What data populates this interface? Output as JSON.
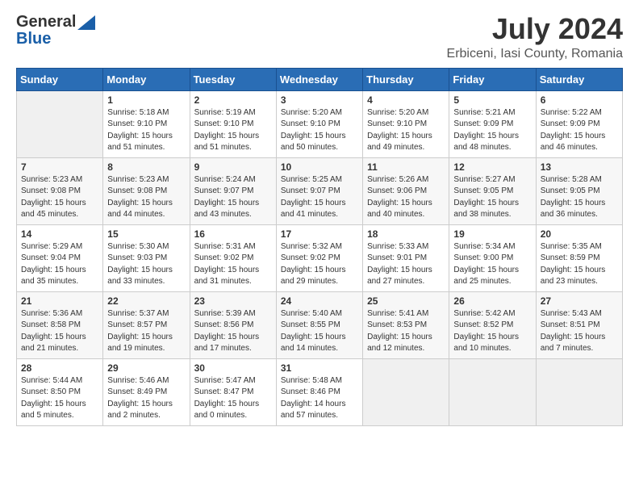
{
  "header": {
    "logo": {
      "general": "General",
      "blue": "Blue"
    },
    "title": "July 2024",
    "subtitle": "Erbiceni, Iasi County, Romania"
  },
  "weekdays": [
    "Sunday",
    "Monday",
    "Tuesday",
    "Wednesday",
    "Thursday",
    "Friday",
    "Saturday"
  ],
  "weeks": [
    [
      {
        "day": "",
        "sunrise": "",
        "sunset": "",
        "daylight": "",
        "empty": true
      },
      {
        "day": "1",
        "sunrise": "Sunrise: 5:18 AM",
        "sunset": "Sunset: 9:10 PM",
        "daylight": "Daylight: 15 hours and 51 minutes."
      },
      {
        "day": "2",
        "sunrise": "Sunrise: 5:19 AM",
        "sunset": "Sunset: 9:10 PM",
        "daylight": "Daylight: 15 hours and 51 minutes."
      },
      {
        "day": "3",
        "sunrise": "Sunrise: 5:20 AM",
        "sunset": "Sunset: 9:10 PM",
        "daylight": "Daylight: 15 hours and 50 minutes."
      },
      {
        "day": "4",
        "sunrise": "Sunrise: 5:20 AM",
        "sunset": "Sunset: 9:10 PM",
        "daylight": "Daylight: 15 hours and 49 minutes."
      },
      {
        "day": "5",
        "sunrise": "Sunrise: 5:21 AM",
        "sunset": "Sunset: 9:09 PM",
        "daylight": "Daylight: 15 hours and 48 minutes."
      },
      {
        "day": "6",
        "sunrise": "Sunrise: 5:22 AM",
        "sunset": "Sunset: 9:09 PM",
        "daylight": "Daylight: 15 hours and 46 minutes."
      }
    ],
    [
      {
        "day": "7",
        "sunrise": "Sunrise: 5:23 AM",
        "sunset": "Sunset: 9:08 PM",
        "daylight": "Daylight: 15 hours and 45 minutes."
      },
      {
        "day": "8",
        "sunrise": "Sunrise: 5:23 AM",
        "sunset": "Sunset: 9:08 PM",
        "daylight": "Daylight: 15 hours and 44 minutes."
      },
      {
        "day": "9",
        "sunrise": "Sunrise: 5:24 AM",
        "sunset": "Sunset: 9:07 PM",
        "daylight": "Daylight: 15 hours and 43 minutes."
      },
      {
        "day": "10",
        "sunrise": "Sunrise: 5:25 AM",
        "sunset": "Sunset: 9:07 PM",
        "daylight": "Daylight: 15 hours and 41 minutes."
      },
      {
        "day": "11",
        "sunrise": "Sunrise: 5:26 AM",
        "sunset": "Sunset: 9:06 PM",
        "daylight": "Daylight: 15 hours and 40 minutes."
      },
      {
        "day": "12",
        "sunrise": "Sunrise: 5:27 AM",
        "sunset": "Sunset: 9:05 PM",
        "daylight": "Daylight: 15 hours and 38 minutes."
      },
      {
        "day": "13",
        "sunrise": "Sunrise: 5:28 AM",
        "sunset": "Sunset: 9:05 PM",
        "daylight": "Daylight: 15 hours and 36 minutes."
      }
    ],
    [
      {
        "day": "14",
        "sunrise": "Sunrise: 5:29 AM",
        "sunset": "Sunset: 9:04 PM",
        "daylight": "Daylight: 15 hours and 35 minutes."
      },
      {
        "day": "15",
        "sunrise": "Sunrise: 5:30 AM",
        "sunset": "Sunset: 9:03 PM",
        "daylight": "Daylight: 15 hours and 33 minutes."
      },
      {
        "day": "16",
        "sunrise": "Sunrise: 5:31 AM",
        "sunset": "Sunset: 9:02 PM",
        "daylight": "Daylight: 15 hours and 31 minutes."
      },
      {
        "day": "17",
        "sunrise": "Sunrise: 5:32 AM",
        "sunset": "Sunset: 9:02 PM",
        "daylight": "Daylight: 15 hours and 29 minutes."
      },
      {
        "day": "18",
        "sunrise": "Sunrise: 5:33 AM",
        "sunset": "Sunset: 9:01 PM",
        "daylight": "Daylight: 15 hours and 27 minutes."
      },
      {
        "day": "19",
        "sunrise": "Sunrise: 5:34 AM",
        "sunset": "Sunset: 9:00 PM",
        "daylight": "Daylight: 15 hours and 25 minutes."
      },
      {
        "day": "20",
        "sunrise": "Sunrise: 5:35 AM",
        "sunset": "Sunset: 8:59 PM",
        "daylight": "Daylight: 15 hours and 23 minutes."
      }
    ],
    [
      {
        "day": "21",
        "sunrise": "Sunrise: 5:36 AM",
        "sunset": "Sunset: 8:58 PM",
        "daylight": "Daylight: 15 hours and 21 minutes."
      },
      {
        "day": "22",
        "sunrise": "Sunrise: 5:37 AM",
        "sunset": "Sunset: 8:57 PM",
        "daylight": "Daylight: 15 hours and 19 minutes."
      },
      {
        "day": "23",
        "sunrise": "Sunrise: 5:39 AM",
        "sunset": "Sunset: 8:56 PM",
        "daylight": "Daylight: 15 hours and 17 minutes."
      },
      {
        "day": "24",
        "sunrise": "Sunrise: 5:40 AM",
        "sunset": "Sunset: 8:55 PM",
        "daylight": "Daylight: 15 hours and 14 minutes."
      },
      {
        "day": "25",
        "sunrise": "Sunrise: 5:41 AM",
        "sunset": "Sunset: 8:53 PM",
        "daylight": "Daylight: 15 hours and 12 minutes."
      },
      {
        "day": "26",
        "sunrise": "Sunrise: 5:42 AM",
        "sunset": "Sunset: 8:52 PM",
        "daylight": "Daylight: 15 hours and 10 minutes."
      },
      {
        "day": "27",
        "sunrise": "Sunrise: 5:43 AM",
        "sunset": "Sunset: 8:51 PM",
        "daylight": "Daylight: 15 hours and 7 minutes."
      }
    ],
    [
      {
        "day": "28",
        "sunrise": "Sunrise: 5:44 AM",
        "sunset": "Sunset: 8:50 PM",
        "daylight": "Daylight: 15 hours and 5 minutes."
      },
      {
        "day": "29",
        "sunrise": "Sunrise: 5:46 AM",
        "sunset": "Sunset: 8:49 PM",
        "daylight": "Daylight: 15 hours and 2 minutes."
      },
      {
        "day": "30",
        "sunrise": "Sunrise: 5:47 AM",
        "sunset": "Sunset: 8:47 PM",
        "daylight": "Daylight: 15 hours and 0 minutes."
      },
      {
        "day": "31",
        "sunrise": "Sunrise: 5:48 AM",
        "sunset": "Sunset: 8:46 PM",
        "daylight": "Daylight: 14 hours and 57 minutes."
      },
      {
        "day": "",
        "sunrise": "",
        "sunset": "",
        "daylight": "",
        "empty": true
      },
      {
        "day": "",
        "sunrise": "",
        "sunset": "",
        "daylight": "",
        "empty": true
      },
      {
        "day": "",
        "sunrise": "",
        "sunset": "",
        "daylight": "",
        "empty": true
      }
    ]
  ]
}
